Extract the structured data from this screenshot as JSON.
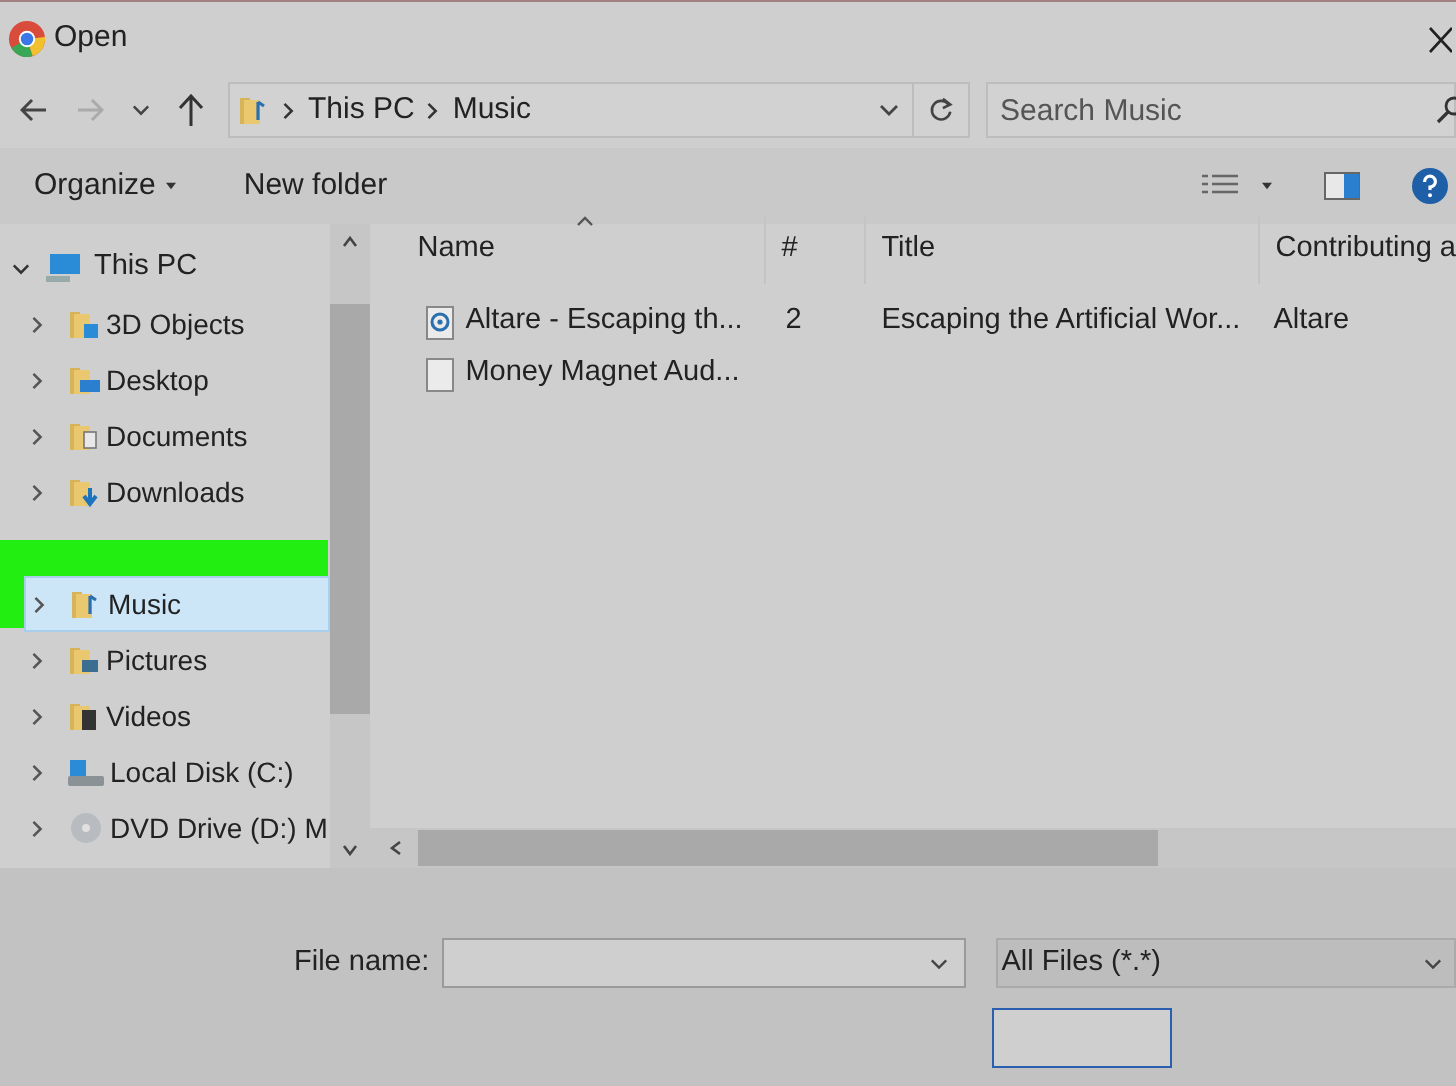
{
  "window": {
    "title": "Open"
  },
  "address": {
    "path": [
      "This PC",
      "Music"
    ]
  },
  "search": {
    "placeholder": "Search Music"
  },
  "toolbar": {
    "buttons": [
      "Organize",
      "New folder"
    ]
  },
  "nav_tree": [
    {
      "label": "This PC",
      "kind": "pc",
      "expanded": true,
      "selected": false,
      "children": [
        {
          "label": "3D Objects",
          "kind": "objects",
          "expanded": false,
          "selected": false
        },
        {
          "label": "Desktop",
          "kind": "desktop",
          "expanded": false,
          "selected": false
        },
        {
          "label": "Documents",
          "kind": "documents",
          "expanded": false,
          "selected": false
        },
        {
          "label": "Downloads",
          "kind": "downloads",
          "expanded": false,
          "selected": false
        },
        {
          "kind": "hidden"
        },
        {
          "label": "Music",
          "kind": "music",
          "expanded": false,
          "selected": true
        },
        {
          "label": "Pictures",
          "kind": "pictures",
          "expanded": false,
          "selected": false
        },
        {
          "label": "Videos",
          "kind": "videos",
          "expanded": false,
          "selected": false
        },
        {
          "label": "Local Disk (C:)",
          "kind": "disk",
          "expanded": false,
          "selected": false
        },
        {
          "label": "DVD Drive (D:) M",
          "kind": "dvd",
          "expanded": false,
          "selected": false
        }
      ]
    }
  ],
  "columns": [
    "Name",
    "#",
    "Title",
    "Contributing a"
  ],
  "files": [
    {
      "kind": "audio",
      "name": "Altare - Escaping th...",
      "number": "2",
      "title": "Escaping the Artificial Wor...",
      "artist": "Altare"
    },
    {
      "kind": "blank",
      "name": "Money Magnet Aud..."
    }
  ],
  "file_name": {
    "label": "File name:"
  },
  "file_type": {
    "value": "All Files (*.*)"
  }
}
